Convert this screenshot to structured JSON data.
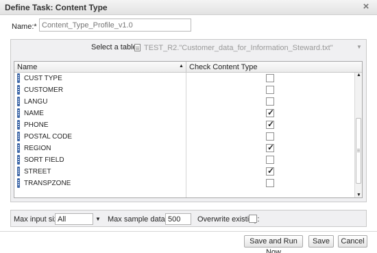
{
  "dialog": {
    "title": "Define Task: Content Type",
    "close_icon": "close-icon"
  },
  "name": {
    "label": "Name:*",
    "placeholder": "Content_Type_Profile_v1.0"
  },
  "table_select": {
    "label": "Select a table*",
    "value": "TEST_R2.\"Customer_data_for_Information_Steward.txt\"",
    "icon": "file-icon",
    "arrow": "▼"
  },
  "grid": {
    "columns": [
      "Name",
      "Check Content Type"
    ],
    "sort_indicator": "▲",
    "rows": [
      {
        "name": "CUST TYPE",
        "checked": false
      },
      {
        "name": "CUSTOMER",
        "checked": false
      },
      {
        "name": "LANGU",
        "checked": false
      },
      {
        "name": "NAME",
        "checked": true
      },
      {
        "name": "PHONE",
        "checked": true
      },
      {
        "name": "POSTAL CODE",
        "checked": false
      },
      {
        "name": "REGION",
        "checked": true
      },
      {
        "name": "SORT FIELD",
        "checked": false
      },
      {
        "name": "STREET",
        "checked": true
      },
      {
        "name": "TRANSPZONE",
        "checked": false
      }
    ],
    "scroll_up": "▲",
    "scroll_down": "▼"
  },
  "options": {
    "max_input_label": "Max input size:",
    "max_input_value": "All",
    "dropdown_arrow": "▼",
    "max_sample_label": "Max sample data size:",
    "max_sample_value": "500",
    "overwrite_label": "Overwrite existing:",
    "overwrite_checked": false
  },
  "buttons": {
    "save_run": "Save and Run Now",
    "save": "Save",
    "cancel": "Cancel"
  },
  "check_mark": "✓"
}
